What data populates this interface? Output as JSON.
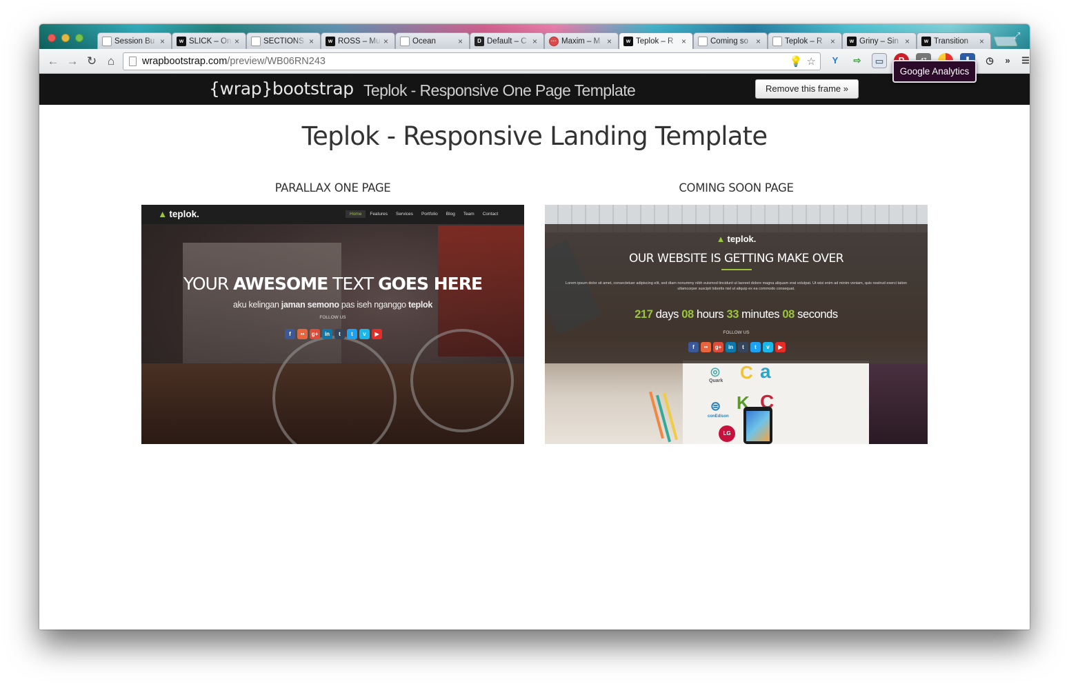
{
  "browser": {
    "tabs": [
      {
        "favicon": "doc-icon",
        "title": "Session Bu",
        "active": false
      },
      {
        "favicon": "w",
        "title": "SLICK – On",
        "active": false
      },
      {
        "favicon": "doc",
        "title": "SECTIONS",
        "active": false
      },
      {
        "favicon": "w",
        "title": "ROSS – Mu",
        "active": false
      },
      {
        "favicon": "doc",
        "title": "Ocean",
        "active": false
      },
      {
        "favicon": "D",
        "title": "Default – C",
        "active": false
      },
      {
        "favicon": "m",
        "title": "Maxim – M",
        "active": false
      },
      {
        "favicon": "w",
        "title": "Teplok – R",
        "active": true
      },
      {
        "favicon": "doc",
        "title": "Coming so",
        "active": false
      },
      {
        "favicon": "doc",
        "title": "Teplok – R",
        "active": false
      },
      {
        "favicon": "w",
        "title": "Griny – Sin",
        "active": false
      },
      {
        "favicon": "w",
        "title": "Transition",
        "active": false
      }
    ],
    "close_glyph": "×",
    "url_host": "wrapbootstrap.com",
    "url_path": "/preview/WB06RN243"
  },
  "wrapbar": {
    "logo": "{wrap}bootstrap",
    "title": "Teplok - Responsive One Page Template",
    "remove_label": "Remove this frame »",
    "analytics_label": "Google Analytics"
  },
  "page": {
    "heading": "Teplok - Responsive Landing Template",
    "cards": [
      {
        "label": "PARALLAX ONE PAGE"
      },
      {
        "label": "COMING SOON PAGE"
      }
    ]
  },
  "preview1": {
    "brand": "teplok.",
    "menu": [
      "Home",
      "Features",
      "Services",
      "Portfolio",
      "Blog",
      "Team",
      "Contact"
    ],
    "headline_1": "YOUR ",
    "headline_2": "AWESOME",
    "headline_3": " TEXT ",
    "headline_4": "GOES HERE",
    "sub_1": "aku kelingan ",
    "sub_2": "jaman semono",
    "sub_3": " pas iseh nganggo ",
    "sub_4": "teplok",
    "follow": "FOLLOW US"
  },
  "preview2": {
    "brand": "teplok.",
    "headline": "OUR WEBSITE IS GETTING MAKE OVER",
    "lorem": "Lorem ipsum dolor sit amet, consectetuer adipiscing elit, sed diam nonummy nibh euismod tincidunt ut laoreet dolore magna aliquam erat volutpat. Ut wisi enim ad minim veniam, quis nostrud exerci tation ullamcorper suscipit lobortis nisl ut aliquip ex ea commodo consequat.",
    "days": "217",
    "days_label": " days ",
    "hours": "08",
    "hours_label": " hours ",
    "minutes": "33",
    "minutes_label": " minutes ",
    "seconds": "08",
    "seconds_label": " seconds",
    "follow": "FOLLOW US",
    "logo_quark": "Quark",
    "logo_conedison": "conEdison",
    "logo_lg": "LG"
  },
  "socials": [
    {
      "icon": "facebook-icon",
      "glyph": "f",
      "color": "#3b5998"
    },
    {
      "icon": "flickr-icon",
      "glyph": "••",
      "color": "#e8643c"
    },
    {
      "icon": "google-plus-icon",
      "glyph": "g+",
      "color": "#dd4b39"
    },
    {
      "icon": "linkedin-icon",
      "glyph": "in",
      "color": "#0e76a8"
    },
    {
      "icon": "tumblr-icon",
      "glyph": "t",
      "color": "#35465c"
    },
    {
      "icon": "twitter-icon",
      "glyph": "t",
      "color": "#1da1f2"
    },
    {
      "icon": "vimeo-icon",
      "glyph": "v",
      "color": "#1ab7ea"
    },
    {
      "icon": "youtube-icon",
      "glyph": "▶",
      "color": "#e52d27"
    }
  ],
  "colors": {
    "accent_green": "#9bc53d",
    "wrapbar_bg": "#141414",
    "analytics_bg": "#2c0a2a"
  }
}
